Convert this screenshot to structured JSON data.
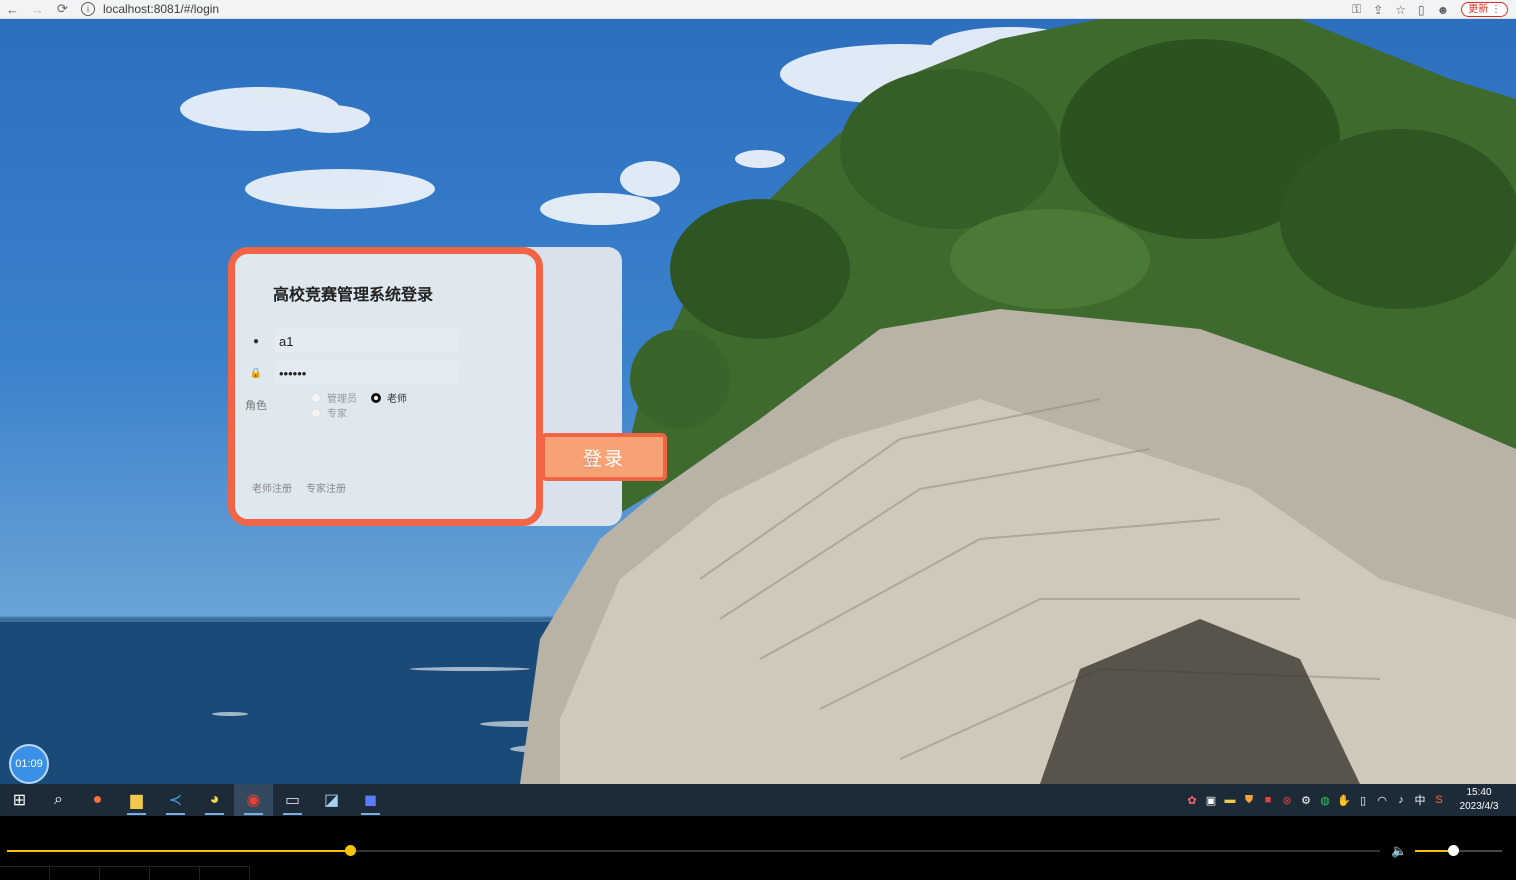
{
  "browser": {
    "back_icon": "←",
    "forward_icon": "→",
    "reload_icon": "⟳",
    "info_icon": "i",
    "url": "localhost:8081/#/login",
    "update_label": "更新",
    "menu_icon": "⋮"
  },
  "login": {
    "title": "高校竞赛管理系统登录",
    "user_icon": "●",
    "username_value": "a1",
    "lock_icon": "🔒",
    "password_value": "••••••",
    "role_label": "角色",
    "roles": [
      "管理员",
      "老师",
      "专家"
    ],
    "selected_role": "老师",
    "login_button": "登录",
    "teacher_register": "老师注册",
    "expert_register": "专家注册"
  },
  "timer": "01:09",
  "taskbar": {
    "clock_time": "15:40",
    "clock_date": "2023/4/3",
    "ime": "中"
  },
  "player": {
    "progress": 0.25,
    "volume": 0.44
  },
  "colors": {
    "accent": "#f16446",
    "button_fill": "#f6a274",
    "seek": "#f5c400"
  }
}
